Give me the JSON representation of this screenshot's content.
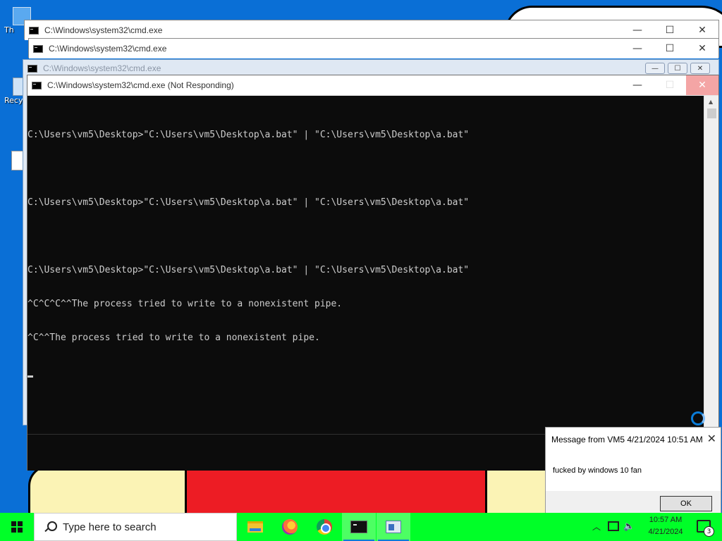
{
  "desktop": {
    "icons": [
      {
        "label": "Th"
      },
      {
        "label": "Recy"
      }
    ]
  },
  "windows": [
    {
      "title": "C:\\Windows\\system32\\cmd.exe"
    },
    {
      "title": "C:\\Windows\\system32\\cmd.exe"
    },
    {
      "title": "C:\\Windows\\system32\\cmd.exe"
    },
    {
      "title": "C:\\Windows\\system32\\cmd.exe (Not Responding)"
    }
  ],
  "window_controls": {
    "minimize": "—",
    "maximize": "☐",
    "close": "✕"
  },
  "console": {
    "lines": [
      "C:\\Users\\vm5\\Desktop>\"C:\\Users\\vm5\\Desktop\\a.bat\" | \"C:\\Users\\vm5\\Desktop\\a.bat\"",
      "",
      "C:\\Users\\vm5\\Desktop>\"C:\\Users\\vm5\\Desktop\\a.bat\" | \"C:\\Users\\vm5\\Desktop\\a.bat\"",
      "",
      "C:\\Users\\vm5\\Desktop>\"C:\\Users\\vm5\\Desktop\\a.bat\" | \"C:\\Users\\vm5\\Desktop\\a.bat\"",
      "^C^C^C^^The process tried to write to a nonexistent pipe.",
      "^C^^The process tried to write to a nonexistent pipe."
    ]
  },
  "message": {
    "header": "Message from VM5 4/21/2024 10:51 AM",
    "body": "fucked by windows 10 fan",
    "ok_label": "OK"
  },
  "taskbar": {
    "search_placeholder": "Type here to search",
    "apps": [
      "file-explorer",
      "firefox",
      "chrome",
      "cmd",
      "control-panel"
    ],
    "time": "10:57 AM",
    "date": "4/21/2024",
    "notification_count": "3",
    "color": "#00ff28"
  }
}
